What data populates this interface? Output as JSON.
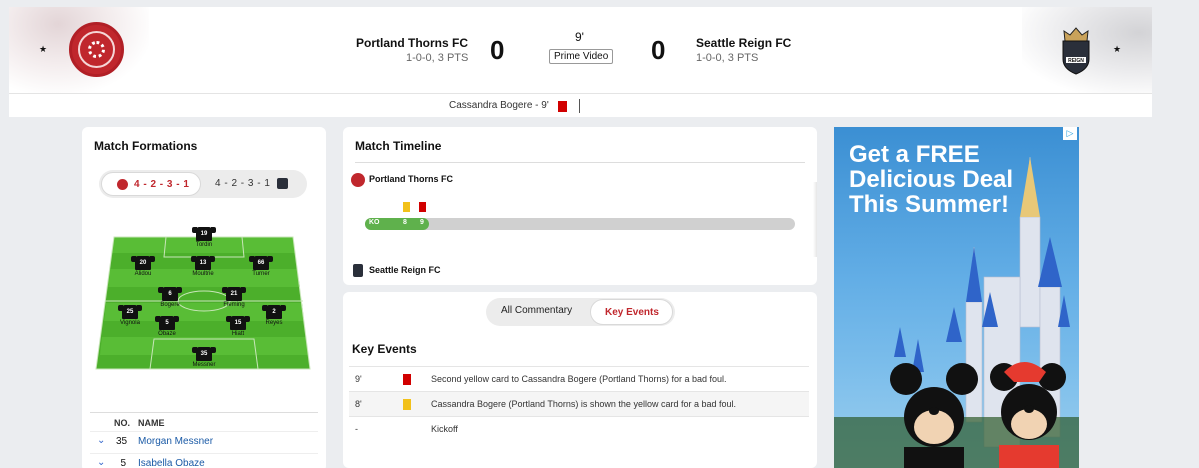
{
  "header": {
    "home": {
      "name": "Portland Thorns FC",
      "record": "1-0-0, 3 PTS",
      "score": "0"
    },
    "away": {
      "name": "Seattle Reign FC",
      "record": "1-0-0, 3 PTS",
      "score": "0"
    },
    "minute": "9'",
    "broadcast": "Prime Video",
    "star": "★"
  },
  "subbar": {
    "event": "Cassandra Bogere - 9'"
  },
  "formations": {
    "title": "Match Formations",
    "home_formation": "4 - 2 - 3 - 1",
    "away_formation": "4 - 2 - 3 - 1",
    "players": [
      {
        "num": "19",
        "name": "Tordin"
      },
      {
        "num": "20",
        "name": "Alidou"
      },
      {
        "num": "13",
        "name": "Moultrie"
      },
      {
        "num": "66",
        "name": "Turner"
      },
      {
        "num": "6",
        "name": "Bogere"
      },
      {
        "num": "21",
        "name": "Fleming"
      },
      {
        "num": "25",
        "name": "Vignola"
      },
      {
        "num": "5",
        "name": "Obaze"
      },
      {
        "num": "15",
        "name": "Hiatt"
      },
      {
        "num": "2",
        "name": "Reyes"
      },
      {
        "num": "35",
        "name": "Messner"
      }
    ],
    "roster_header": {
      "no": "NO.",
      "name": "NAME"
    },
    "roster": [
      {
        "num": "35",
        "name": "Morgan Messner"
      },
      {
        "num": "5",
        "name": "Isabella Obaze"
      }
    ]
  },
  "timeline": {
    "title": "Match Timeline",
    "home_team": "Portland Thorns FC",
    "away_team": "Seattle Reign FC",
    "ko": "KO",
    "mark_8": "8",
    "mark_9": "9"
  },
  "events": {
    "tabs": {
      "all": "All Commentary",
      "key": "Key Events"
    },
    "title": "Key Events",
    "rows": [
      {
        "minute": "9'",
        "card": "red",
        "text": "Second yellow card to Cassandra Bogere (Portland Thorns) for a bad foul."
      },
      {
        "minute": "8'",
        "card": "yellow",
        "text": "Cassandra Bogere (Portland Thorns) is shown the yellow card for a bad foul."
      },
      {
        "minute": "-",
        "card": "",
        "text": "Kickoff"
      }
    ]
  },
  "ad": {
    "headline": "Get a FREE Delicious Deal This Summer!",
    "badge": "▷"
  },
  "colors": {
    "thorns_red": "#c0272d",
    "pitch_green": "#4caf2b",
    "red_card": "#d10000",
    "yellow_card": "#f2c11a",
    "link_blue": "#1a5aa6"
  }
}
